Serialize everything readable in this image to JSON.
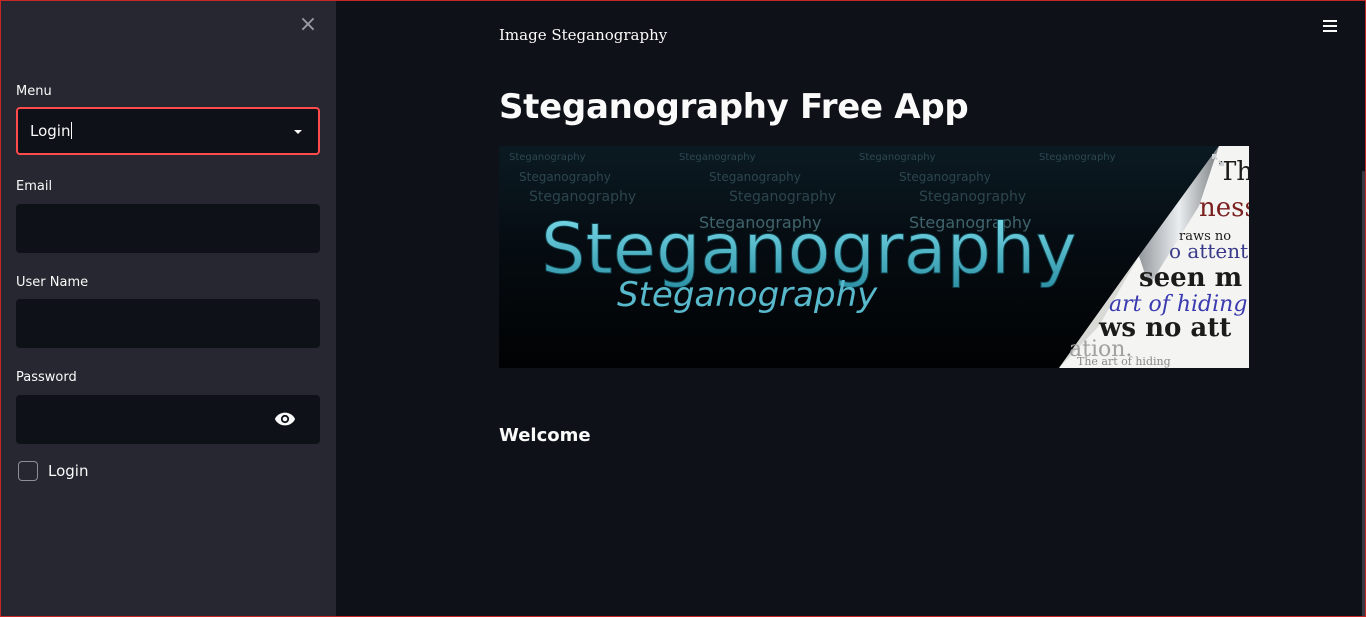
{
  "sidebar": {
    "close_icon": "×",
    "menu": {
      "label": "Menu",
      "selected": "Login"
    },
    "email": {
      "label": "Email",
      "value": ""
    },
    "username": {
      "label": "User Name",
      "value": ""
    },
    "password": {
      "label": "Password",
      "value": ""
    },
    "login_checkbox": {
      "label": "Login",
      "checked": false
    }
  },
  "main": {
    "page_heading": "Image Steganography",
    "title": "Steganography Free App",
    "banner": {
      "main_word": "Steganography",
      "sub_word": "Steganography",
      "row_words": "Steganography",
      "peel_lines": [
        "Th",
        "ness",
        "raws no",
        "o attent",
        "seen m",
        "art of hiding i",
        "ws no att",
        "ation.",
        "The art of hiding"
      ]
    },
    "welcome": "Welcome"
  },
  "colors": {
    "sidebar_bg": "#262730",
    "main_bg": "#0e1117",
    "accent": "#ff4b4b",
    "text": "#fafafa"
  }
}
